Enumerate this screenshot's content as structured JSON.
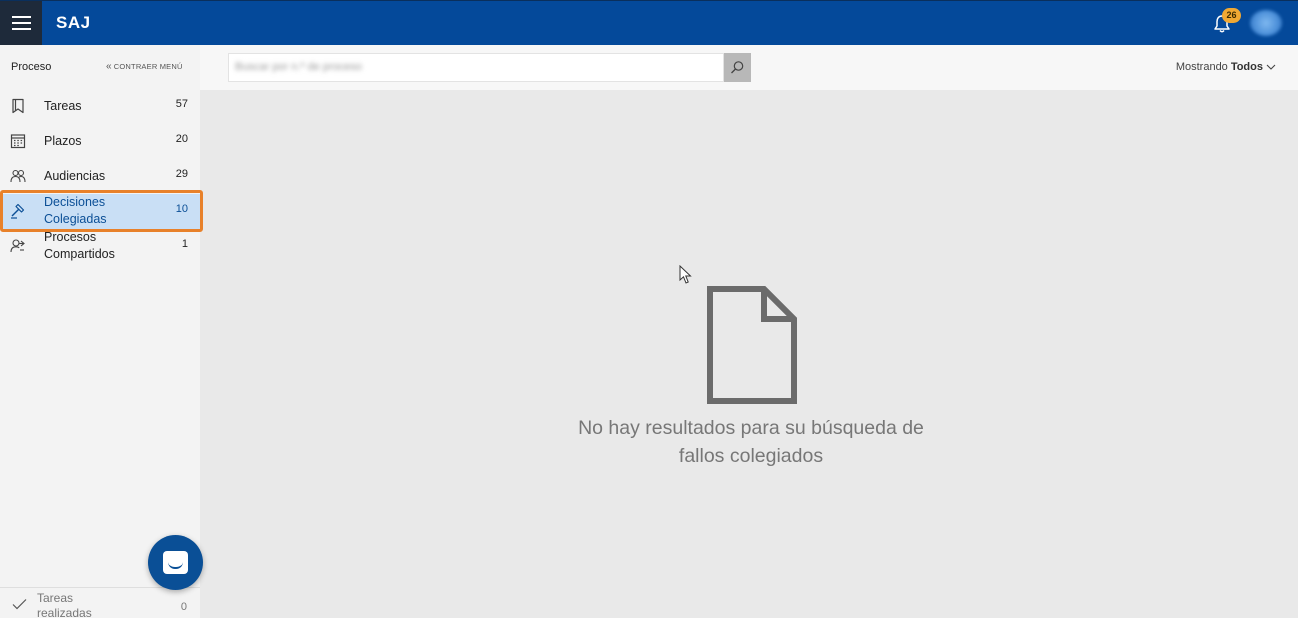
{
  "app": {
    "brand": "SAJ",
    "notification_count": "26"
  },
  "sidebar": {
    "title": "Proceso",
    "collapse_label": "CONTRAER MENÚ",
    "items": [
      {
        "label": "Tareas",
        "count": "57",
        "icon": "bookmark-icon"
      },
      {
        "label": "Plazos",
        "count": "20",
        "icon": "calendar-icon"
      },
      {
        "label": "Audiencias",
        "count": "29",
        "icon": "people-icon"
      },
      {
        "label_line1": "Decisiones",
        "label_line2": "Colegiadas",
        "count": "10",
        "icon": "gavel-icon",
        "active": true
      },
      {
        "label_line1": "Procesos",
        "label_line2": "Compartidos",
        "count": "1",
        "icon": "shared-user-icon"
      }
    ],
    "footer": {
      "label_line1": "Tareas",
      "label_line2": "realizadas",
      "count": "0",
      "icon": "check-icon"
    }
  },
  "toolbar": {
    "search_placeholder": "Buscar por n.º de proceso",
    "showing_label": "Mostrando",
    "showing_value": "Todos"
  },
  "main": {
    "empty_line1": "No hay resultados para su búsqueda de",
    "empty_line2": "fallos colegiados"
  },
  "colors": {
    "topbar": "#04499a",
    "active_item": "#c9dff5",
    "highlight": "#e8812a",
    "badge": "#f0a833"
  }
}
